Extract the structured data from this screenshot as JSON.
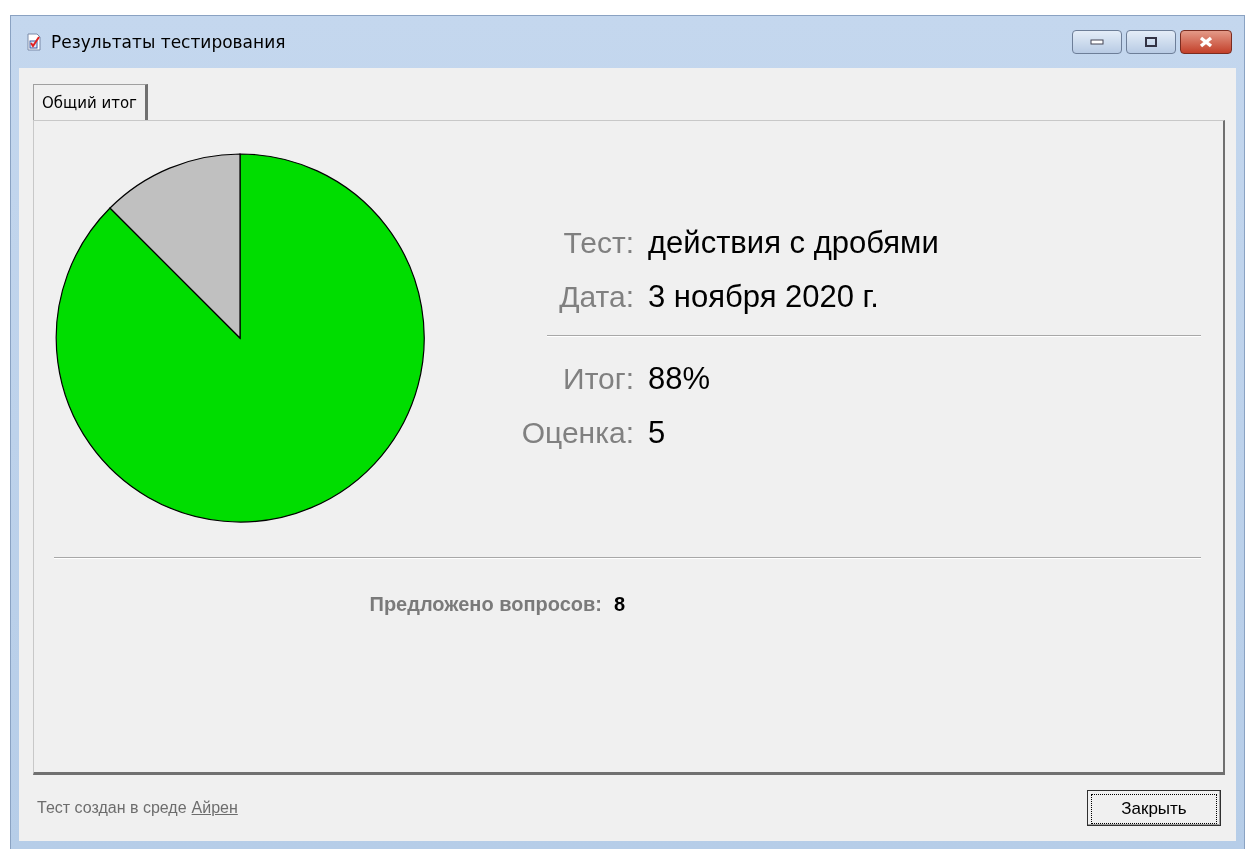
{
  "window": {
    "title": "Результаты тестирования"
  },
  "tabs": [
    {
      "label": "Общий итог",
      "selected": true
    }
  ],
  "details": [
    {
      "label": "Тест:",
      "value": "действия с дробями"
    },
    {
      "label": "Дата:",
      "value": "3 ноября 2020 г."
    }
  ],
  "results": [
    {
      "label": "Итог:",
      "value": "88%"
    },
    {
      "label": "Оценка:",
      "value": "5"
    }
  ],
  "questions": {
    "label": "Предложено вопросов:",
    "value": "8"
  },
  "footer": {
    "text": "Тест создан в среде",
    "link": "Айрен"
  },
  "buttons": [
    "Закрыть"
  ]
}
